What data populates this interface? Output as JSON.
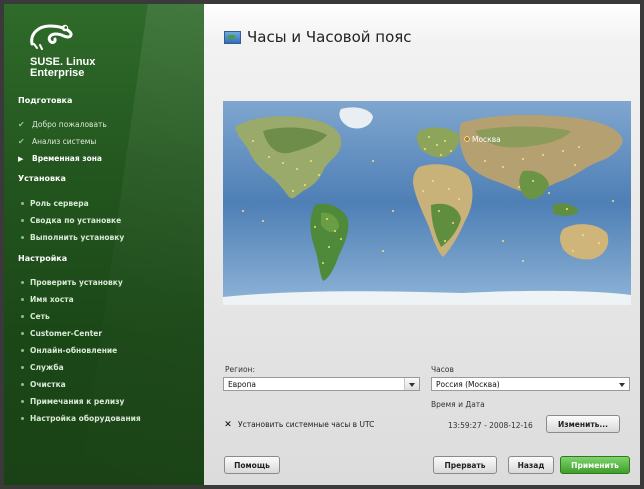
{
  "brand": {
    "line1": "SUSE. Linux",
    "line2": "Enterprise",
    "logo_icon": "suse-chameleon-icon"
  },
  "sidebar": {
    "sections": [
      {
        "title": "Подготовка"
      },
      {
        "title": "Установка"
      },
      {
        "title": "Настройка"
      }
    ],
    "prep_items": [
      {
        "label": "Добро пожаловать",
        "state": "done"
      },
      {
        "label": "Анализ системы",
        "state": "done"
      },
      {
        "label": "Временная зона",
        "state": "current"
      }
    ],
    "install_items": [
      {
        "label": "Роль сервера"
      },
      {
        "label": "Сводка по установке"
      },
      {
        "label": "Выполнить установку"
      }
    ],
    "config_items": [
      {
        "label": "Проверить установку"
      },
      {
        "label": "Имя хоста"
      },
      {
        "label": "Сеть"
      },
      {
        "label": "Customer-Center"
      },
      {
        "label": "Онлайн-обновление"
      },
      {
        "label": "Служба"
      },
      {
        "label": "Очистка"
      },
      {
        "label": "Примечания к релизу"
      },
      {
        "label": "Настройка оборудования"
      }
    ]
  },
  "header": {
    "title": "Часы и Часовой пояс",
    "icon": "world-clock-icon"
  },
  "map": {
    "selected_city": "Москва"
  },
  "region": {
    "label": "Регион:",
    "value": "Европа"
  },
  "clock": {
    "label": "Часов",
    "value": "Россия (Москва)"
  },
  "datetime": {
    "label": "Время и Дата",
    "value": "13:59:27 - 2008-12-16",
    "change_button": "Изменить..."
  },
  "utc": {
    "label": "Установить системные часы в UTC",
    "checked": true
  },
  "buttons": {
    "help": "Помощь",
    "abort": "Прервать",
    "back": "Назад",
    "apply": "Применить"
  },
  "colors": {
    "sidebar": "#23561f",
    "accent_green": "#4fae3a",
    "map_ocean": "#5a86b8"
  }
}
